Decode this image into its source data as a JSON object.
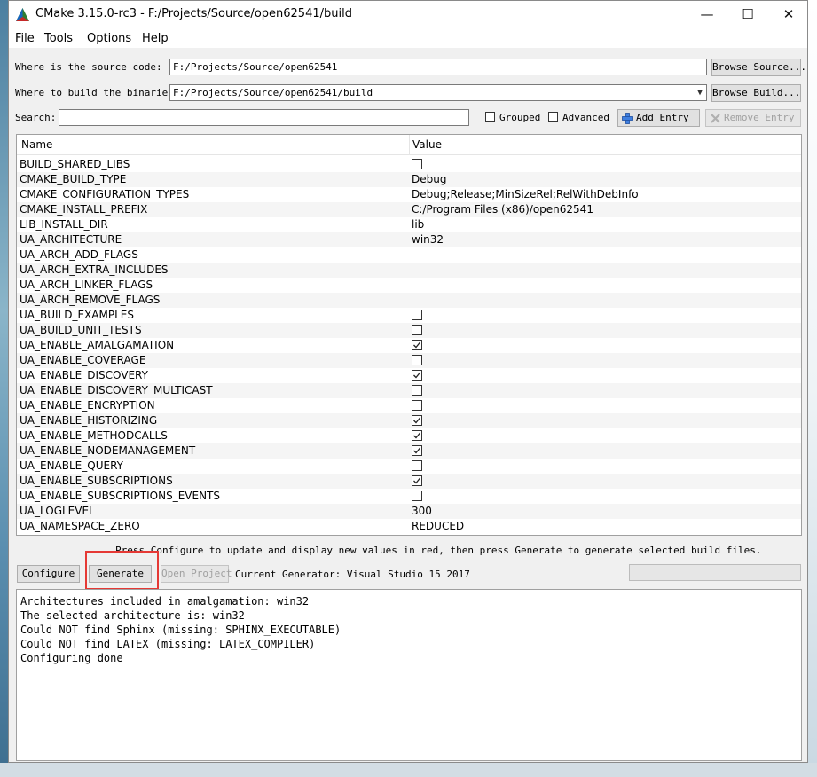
{
  "window": {
    "title": "CMake 3.15.0-rc3 - F:/Projects/Source/open62541/build",
    "controls": {
      "minimize": "—",
      "maximize": "☐",
      "close": "✕"
    }
  },
  "menu": {
    "items": [
      "File",
      "Tools",
      "Options",
      "Help"
    ]
  },
  "source": {
    "label": "Where is the source code:",
    "value": "F:/Projects/Source/open62541",
    "browse_label": "Browse Source..."
  },
  "build": {
    "label": "Where to build the binaries:",
    "value": "F:/Projects/Source/open62541/build",
    "browse_label": "Browse Build..."
  },
  "search": {
    "label": "Search:",
    "value": "",
    "grouped_label": "Grouped",
    "advanced_label": "Advanced",
    "add_entry_label": "Add Entry",
    "remove_entry_label": "Remove Entry"
  },
  "table": {
    "col_name": "Name",
    "col_value": "Value",
    "rows": [
      {
        "name": "BUILD_SHARED_LIBS",
        "type": "bool",
        "checked": false
      },
      {
        "name": "CMAKE_BUILD_TYPE",
        "type": "text",
        "value": "Debug"
      },
      {
        "name": "CMAKE_CONFIGURATION_TYPES",
        "type": "text",
        "value": "Debug;Release;MinSizeRel;RelWithDebInfo"
      },
      {
        "name": "CMAKE_INSTALL_PREFIX",
        "type": "text",
        "value": "C:/Program Files (x86)/open62541"
      },
      {
        "name": "LIB_INSTALL_DIR",
        "type": "text",
        "value": "lib"
      },
      {
        "name": "UA_ARCHITECTURE",
        "type": "text",
        "value": "win32"
      },
      {
        "name": "UA_ARCH_ADD_FLAGS",
        "type": "text",
        "value": ""
      },
      {
        "name": "UA_ARCH_EXTRA_INCLUDES",
        "type": "text",
        "value": ""
      },
      {
        "name": "UA_ARCH_LINKER_FLAGS",
        "type": "text",
        "value": ""
      },
      {
        "name": "UA_ARCH_REMOVE_FLAGS",
        "type": "text",
        "value": ""
      },
      {
        "name": "UA_BUILD_EXAMPLES",
        "type": "bool",
        "checked": false
      },
      {
        "name": "UA_BUILD_UNIT_TESTS",
        "type": "bool",
        "checked": false
      },
      {
        "name": "UA_ENABLE_AMALGAMATION",
        "type": "bool",
        "checked": true
      },
      {
        "name": "UA_ENABLE_COVERAGE",
        "type": "bool",
        "checked": false
      },
      {
        "name": "UA_ENABLE_DISCOVERY",
        "type": "bool",
        "checked": true
      },
      {
        "name": "UA_ENABLE_DISCOVERY_MULTICAST",
        "type": "bool",
        "checked": false
      },
      {
        "name": "UA_ENABLE_ENCRYPTION",
        "type": "bool",
        "checked": false
      },
      {
        "name": "UA_ENABLE_HISTORIZING",
        "type": "bool",
        "checked": true
      },
      {
        "name": "UA_ENABLE_METHODCALLS",
        "type": "bool",
        "checked": true
      },
      {
        "name": "UA_ENABLE_NODEMANAGEMENT",
        "type": "bool",
        "checked": true
      },
      {
        "name": "UA_ENABLE_QUERY",
        "type": "bool",
        "checked": false
      },
      {
        "name": "UA_ENABLE_SUBSCRIPTIONS",
        "type": "bool",
        "checked": true
      },
      {
        "name": "UA_ENABLE_SUBSCRIPTIONS_EVENTS",
        "type": "bool",
        "checked": false
      },
      {
        "name": "UA_LOGLEVEL",
        "type": "text",
        "value": "300"
      },
      {
        "name": "UA_NAMESPACE_ZERO",
        "type": "text",
        "value": "REDUCED"
      }
    ]
  },
  "hint": "Press Configure to update and display new values in red, then press Generate to generate selected build files.",
  "actions": {
    "configure_label": "Configure",
    "generate_label": "Generate",
    "open_project_label": "Open Project",
    "current_generator": "Current Generator: Visual Studio 15 2017"
  },
  "output": {
    "lines": [
      "Architectures included in amalgamation: win32",
      "The selected architecture is: win32",
      "Could NOT find Sphinx (missing: SPHINX_EXECUTABLE)",
      "Could NOT find LATEX (missing: LATEX_COMPILER)",
      "Configuring done"
    ]
  },
  "colors": {
    "highlight": "#e53935",
    "window_bg": "#f0f0f0"
  }
}
